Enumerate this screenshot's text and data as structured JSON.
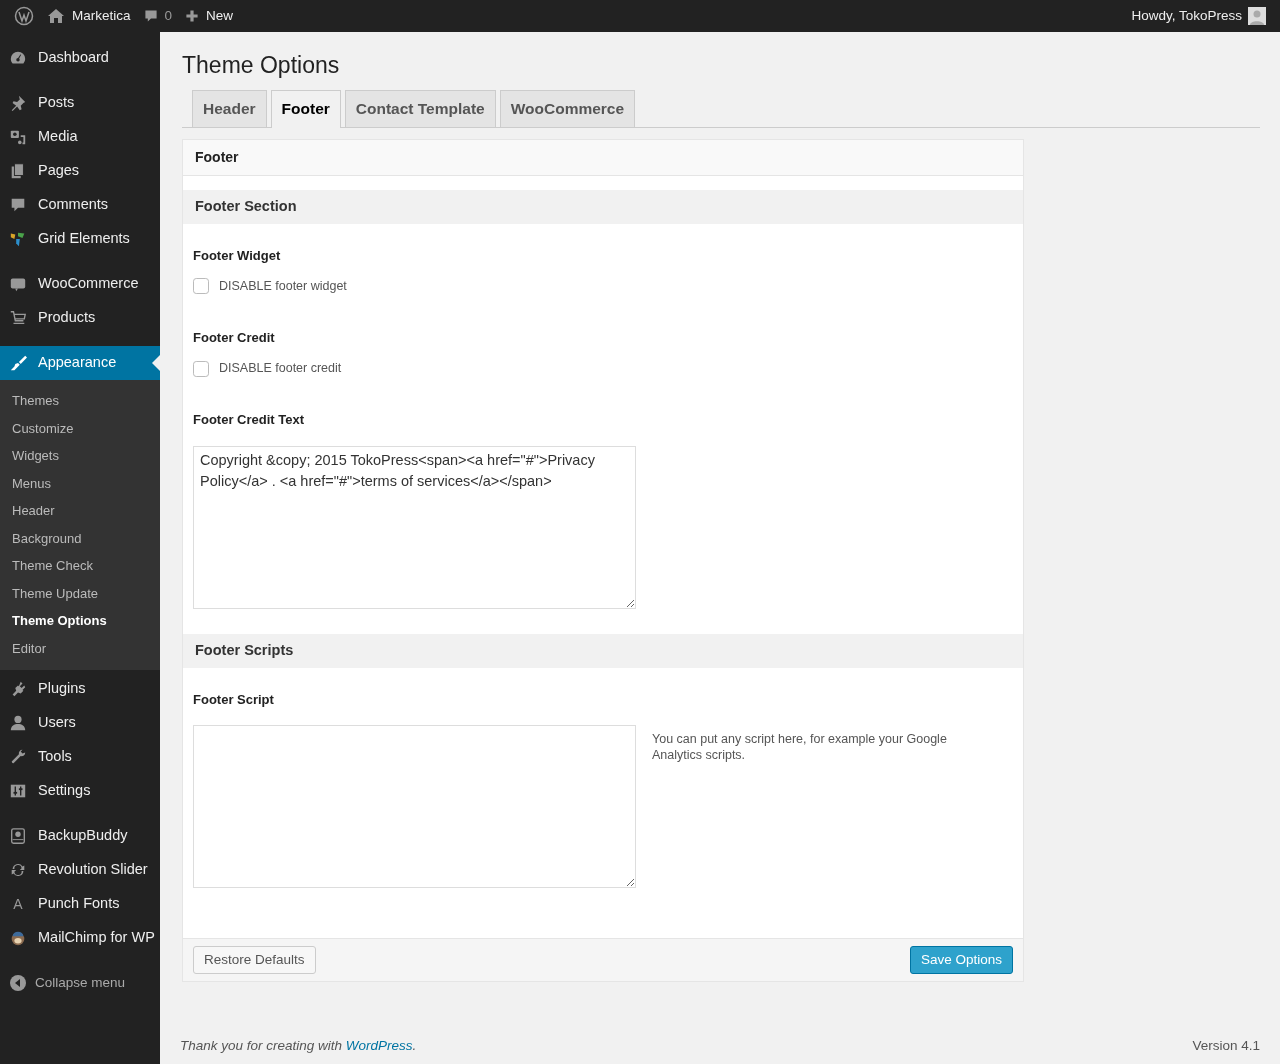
{
  "admin_bar": {
    "site": "Marketica",
    "comments": "0",
    "new": "New",
    "greeting": "Howdy, TokoPress"
  },
  "sidebar": {
    "groups": [
      {
        "items": [
          {
            "label": "Dashboard",
            "selected": false
          }
        ]
      },
      {
        "items": [
          {
            "label": "Posts",
            "selected": false
          },
          {
            "label": "Media",
            "selected": false
          },
          {
            "label": "Pages",
            "selected": false
          },
          {
            "label": "Comments",
            "selected": false
          },
          {
            "label": "Grid Elements",
            "selected": false
          }
        ]
      },
      {
        "items": [
          {
            "label": "WooCommerce",
            "selected": false
          },
          {
            "label": "Products",
            "selected": false
          }
        ]
      },
      {
        "items": [
          {
            "label": "Appearance",
            "selected": true,
            "expanded": true,
            "children": [
              {
                "label": "Themes",
                "selected": false
              },
              {
                "label": "Customize",
                "selected": false
              },
              {
                "label": "Widgets",
                "selected": false
              },
              {
                "label": "Menus",
                "selected": false
              },
              {
                "label": "Header",
                "selected": false
              },
              {
                "label": "Background",
                "selected": false
              },
              {
                "label": "Theme Check",
                "selected": false
              },
              {
                "label": "Theme Update",
                "selected": false
              },
              {
                "label": "Theme Options",
                "selected": true
              },
              {
                "label": "Editor",
                "selected": false
              }
            ]
          },
          {
            "label": "Plugins",
            "selected": false
          },
          {
            "label": "Users",
            "selected": false
          },
          {
            "label": "Tools",
            "selected": false
          },
          {
            "label": "Settings",
            "selected": false
          }
        ]
      },
      {
        "items": [
          {
            "label": "BackupBuddy",
            "selected": false
          },
          {
            "label": "Revolution Slider",
            "selected": false
          },
          {
            "label": "Punch Fonts",
            "selected": false,
            "icon_text": "A"
          },
          {
            "label": "MailChimp for WP",
            "selected": false
          }
        ]
      }
    ],
    "collapse": "Collapse menu"
  },
  "page": {
    "title": "Theme Options",
    "tabs": [
      {
        "label": "Header",
        "selected": false
      },
      {
        "label": "Footer",
        "selected": true
      },
      {
        "label": "Contact Template",
        "selected": false
      },
      {
        "label": "WooCommerce",
        "selected": false
      }
    ],
    "panel_title": "Footer",
    "sections": [
      {
        "title": "Footer Section",
        "fields": [
          {
            "kind": "checkbox",
            "label": "Footer Widget",
            "option": "DISABLE footer widget",
            "checked": false
          },
          {
            "kind": "checkbox",
            "label": "Footer Credit",
            "option": "DISABLE footer credit",
            "checked": false
          },
          {
            "kind": "textarea",
            "label": "Footer Credit Text",
            "value": "Copyright &copy; 2015 TokoPress<span><a href=\"#\">Privacy Policy</a> . <a href=\"#\">terms of services</a></span>"
          }
        ]
      },
      {
        "title": "Footer Scripts",
        "fields": [
          {
            "kind": "textarea",
            "label": "Footer Script",
            "help": "You can put any script here, for example your Google Analytics scripts."
          }
        ]
      }
    ],
    "restore_button": "Restore Defaults",
    "save_button": "Save Options"
  },
  "footer": {
    "thanks": "Thank you for creating with ",
    "link": "WordPress",
    "end": ".",
    "version": "Version 4.1"
  }
}
